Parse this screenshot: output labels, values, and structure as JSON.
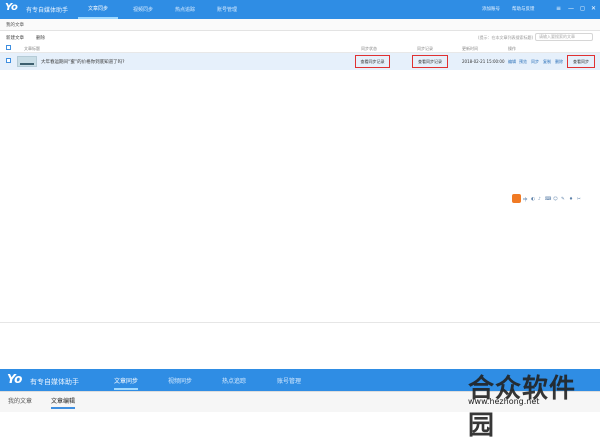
{
  "app": {
    "logo": "Yo",
    "title": "有专自媒体助手"
  },
  "nav": {
    "tabs": [
      {
        "label": "文章同步"
      },
      {
        "label": "视频同步"
      },
      {
        "label": "热点追踪"
      },
      {
        "label": "账号管理"
      }
    ]
  },
  "top_right": {
    "login_account": "添加账号",
    "upgrade": "帮助与反馈"
  },
  "window_controls": {
    "menu": "≡",
    "min": "—",
    "restore": "◻",
    "close": "✕"
  },
  "subtabs": {
    "my_articles": "我的文章"
  },
  "toolbar": {
    "new_article": "新建文章",
    "delete": "删除",
    "search_hint": "(提示：在本文章列表搜索标题)",
    "search_placeholder": "请输入要搜索的文章"
  },
  "table": {
    "headers": {
      "title": "文章标题",
      "sync_status": "同步状态",
      "sync_record": "同步记录",
      "updated": "更新时间",
      "ops": "操作"
    },
    "rows": [
      {
        "title": "大年春运期间“蜜”的价格你到底知道了吗?",
        "sync_status": "查看同步记录",
        "sync_record": "查看同步记录",
        "updated": "2018-02-21 15:00:00",
        "ops": [
          "编辑",
          "预览",
          "同步",
          "复制",
          "删除",
          "查看同步"
        ]
      }
    ]
  },
  "mini_toolbar": {
    "items": [
      "中",
      "◐",
      "♪",
      "⌨",
      "☺",
      "✎",
      "♦",
      "✂"
    ]
  },
  "bottom": {
    "logo": "Yo",
    "title": "有专自媒体助手",
    "tabs": [
      {
        "label": "文章同步"
      },
      {
        "label": "视频同步"
      },
      {
        "label": "热点追踪"
      },
      {
        "label": "账号管理"
      }
    ],
    "subtabs": [
      {
        "label": "我的文章"
      },
      {
        "label": "文章编辑"
      }
    ]
  },
  "watermark": {
    "main": "合众软件园",
    "url": "www.hezhong.net"
  }
}
